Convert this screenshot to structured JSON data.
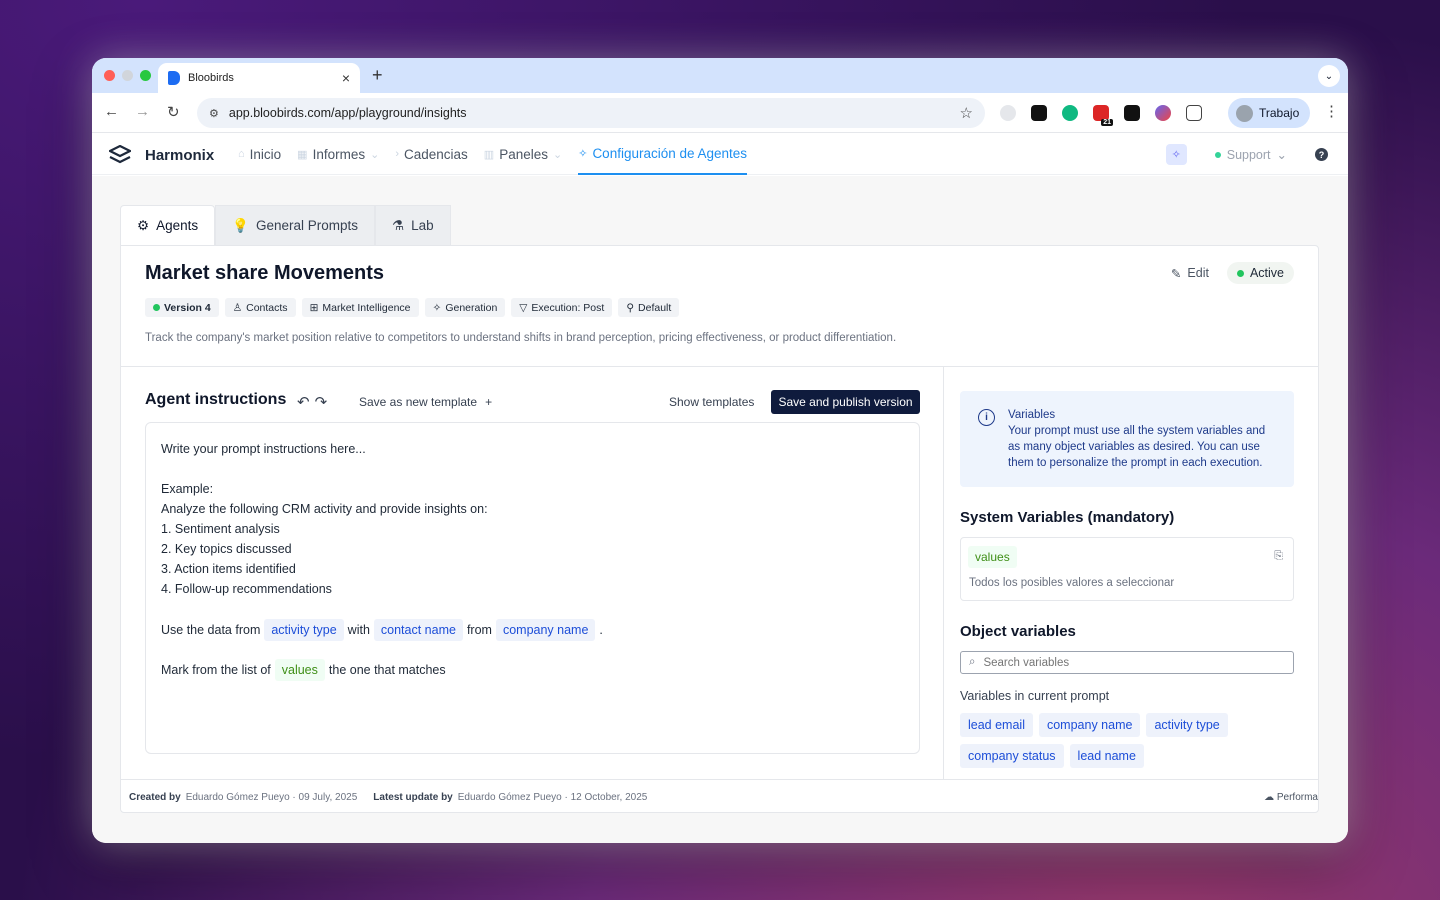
{
  "browser": {
    "tab_title": "Bloobirds",
    "url": "app.bloobirds.com/app/playground/insights",
    "profile_name": "Trabajo",
    "extension_badge": "21"
  },
  "app": {
    "brand": "Harmonix",
    "nav": [
      {
        "label": "Inicio",
        "icon": "home-icon"
      },
      {
        "label": "Informes",
        "icon": "report-icon",
        "dropdown": true
      },
      {
        "label": "Cadencias",
        "icon": "play-icon"
      },
      {
        "label": "Paneles",
        "icon": "chart-icon",
        "dropdown": true
      },
      {
        "label": "Configuración de Agentes",
        "icon": "wand-icon",
        "active": true
      }
    ],
    "support_label": "Support"
  },
  "page_tabs": [
    "Agents",
    "General Prompts",
    "Lab"
  ],
  "agent": {
    "title": "Market share Movements",
    "edit_label": "Edit",
    "status": "Active",
    "chips": [
      "Version 4",
      "Contacts",
      "Market Intelligence",
      "Generation",
      "Execution: Post",
      "Default"
    ],
    "description": "Track the company's market position relative to competitors to understand shifts in brand perception, pricing effectiveness, or product differentiation."
  },
  "instructions": {
    "title": "Agent instructions",
    "save_template": "Save as new template",
    "show_templates": "Show templates",
    "publish": "Save and publish version",
    "lines": [
      "Write your prompt instructions here...",
      "",
      "Example:",
      "Analyze the following CRM activity and provide insights on:",
      "1. Sentiment analysis",
      "2. Key topics discussed",
      "3. Action items identified",
      "4. Follow-up recommendations"
    ],
    "use_data": {
      "t1": "Use the data from",
      "v1": "activity type",
      "t2": "with",
      "v2": "contact name",
      "t3": "from",
      "v3": "company name",
      "t4": "."
    },
    "mark": {
      "t1": "Mark from the list of",
      "v1": "values",
      "t2": "the one that matches"
    }
  },
  "variables_panel": {
    "info_title": "Variables",
    "info_text": "Your prompt must use all the system variables and as many object variables as desired. You can use them to personalize the prompt in each execution.",
    "system_title": "System Variables (mandatory)",
    "system_var": "values",
    "system_var_desc": "Todos los posibles valores a seleccionar",
    "object_title": "Object variables",
    "search_placeholder": "Search variables",
    "current_label": "Variables in current prompt",
    "current_vars": [
      "lead email",
      "company name",
      "activity type",
      "company status",
      "lead name"
    ]
  },
  "footer": {
    "created_label": "Created by",
    "created_value": "Eduardo Gómez Pueyo · 09 July, 2025",
    "updated_label": "Latest update by",
    "updated_value": "Eduardo Gómez Pueyo · 12 October, 2025",
    "performance": "Performa"
  },
  "colors": {
    "accent": "#1d8ff0",
    "publish_bg": "#0f1b3d",
    "active_green": "#22c55e"
  }
}
